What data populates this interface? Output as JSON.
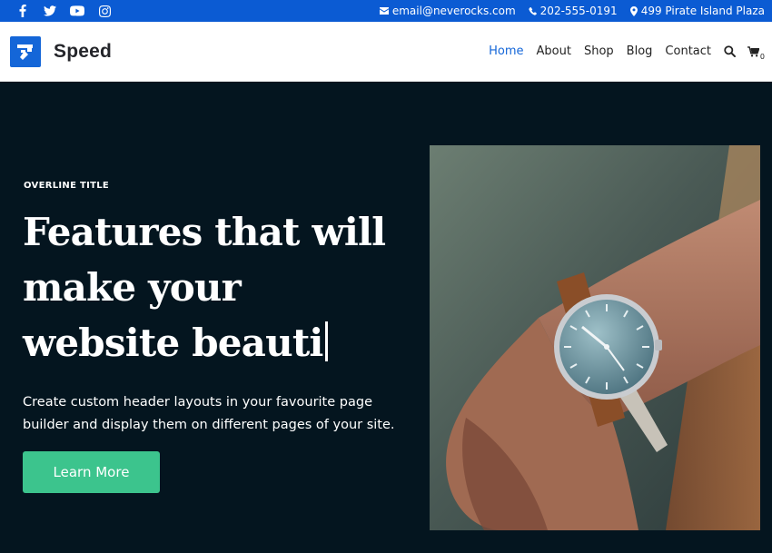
{
  "topbar": {
    "social": [
      {
        "icon": "facebook-icon"
      },
      {
        "icon": "twitter-icon"
      },
      {
        "icon": "youtube-icon"
      },
      {
        "icon": "instagram-icon"
      }
    ],
    "email": "email@neverocks.com",
    "phone": "202-555-0191",
    "address": "499 Pirate Island Plaza"
  },
  "header": {
    "brand": "Speed",
    "nav": [
      "Home",
      "About",
      "Shop",
      "Blog",
      "Contact"
    ],
    "active_nav": "Home",
    "cart_count": "0"
  },
  "hero": {
    "overline": "OVERLINE TITLE",
    "headline_lines": [
      "Features that will",
      "make your",
      "website beauti"
    ],
    "description": "Create custom header layouts in your favourite page builder and display them on different pages of your site.",
    "cta_label": "Learn More",
    "image_subject": "wristwatch-photo"
  },
  "colors": {
    "topbar_bg": "#0b5bd3",
    "accent": "#1466d8",
    "hero_bg": "#04151f",
    "cta_bg": "#3cc48d"
  }
}
